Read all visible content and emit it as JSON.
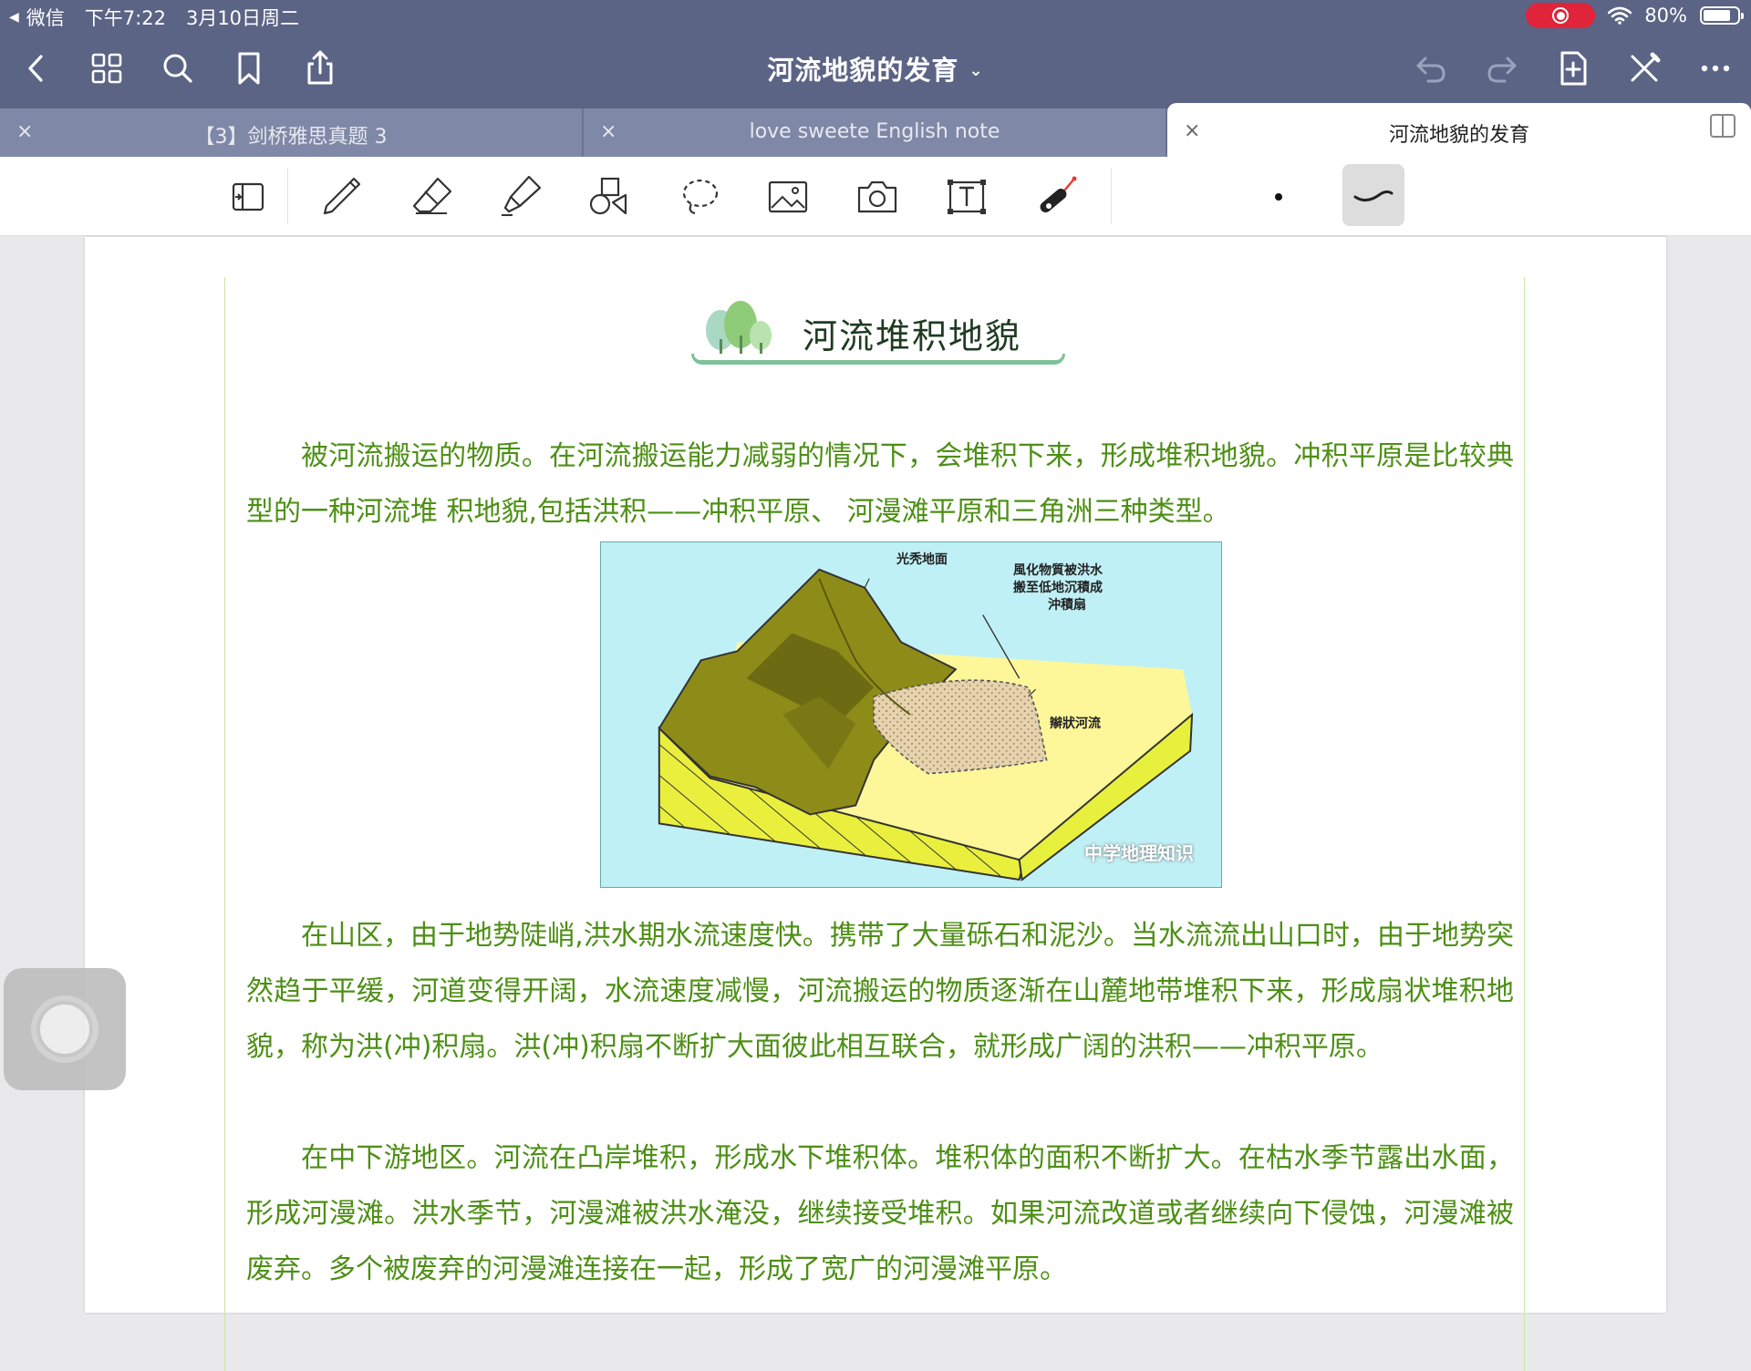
{
  "status_bar": {
    "back_app": "微信",
    "time": "下午7:22",
    "date": "3月10日周二",
    "battery": "80%",
    "battery_level": 0.8
  },
  "nav": {
    "title": "河流地貌的发育",
    "title_dropdown_icon": "chevron-down-icon"
  },
  "tabs": [
    {
      "label": "【3】剑桥雅思真题 3",
      "active": false
    },
    {
      "label": "love sweete English note",
      "active": false
    },
    {
      "label": "河流地貌的发育",
      "active": true
    }
  ],
  "tab_close_glyph": "×",
  "document": {
    "heading": "河流堆积地貌",
    "para1": "被河流搬运的物质。在河流搬运能力减弱的情况下，会堆积下来，形成堆积地貌。冲积平原是比较典型的一种河流堆 积地貌,包括洪积——冲积平原、 河漫滩平原和三角洲三种类型。",
    "illustration_labels": {
      "bare_ground": "光秃地面",
      "weathered": [
        "風化物質被洪水",
        "搬至低地沉積成",
        "沖積扇"
      ],
      "braided": "辮狀河流",
      "watermark": "中学地理知识"
    },
    "para2": "在山区，由于地势陡峭,洪水期水流速度快。携带了大量砾石和泥沙。当水流流出山口时，由于地势突然趋于平缓，河道变得开阔，水流速度减慢，河流搬运的物质逐渐在山麓地带堆积下来，形成扇状堆积地貌，称为洪(冲)积扇。洪(冲)积扇不断扩大面彼此相互联合，就形成广阔的洪积——冲积平原。",
    "para3": "在中下游地区。河流在凸岸堆积，形成水下堆积体。堆积体的面积不断扩大。在枯水季节露出水面，形成河漫滩。洪水季节，河漫滩被洪水淹没，继续接受堆积。如果河流改道或者继续向下侵蚀，河漫滩被废弃。多个被废弃的河漫滩连接在一起，形成了宽广的河漫滩平原。"
  },
  "colors": {
    "nav_bg": "#5b6485",
    "tab_bar_bg": "#7f88a6",
    "body_text": "#4d8f15",
    "page_border": "#c9e6a2",
    "heading_underline": "#7dc29a",
    "record_pill": "#e0243a"
  }
}
